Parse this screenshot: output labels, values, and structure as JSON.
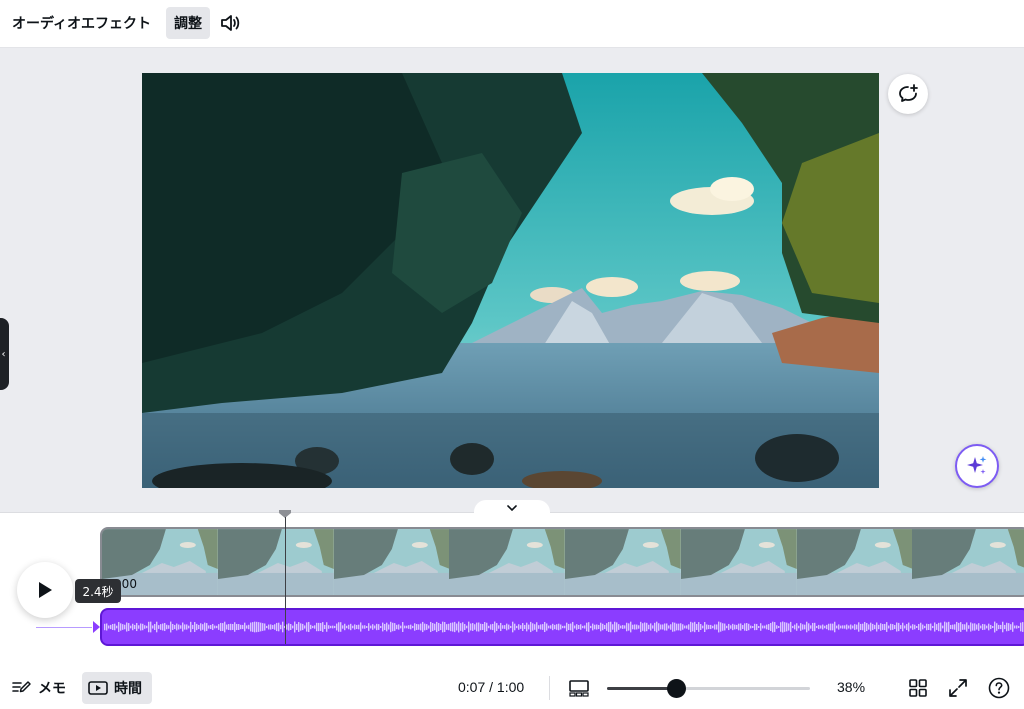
{
  "toolbar": {
    "audio_effects_label": "オーディオエフェクト",
    "adjust_label": "調整",
    "volume_icon": "speaker-icon"
  },
  "canvas": {
    "comment_icon": "comment-plus-icon",
    "magic_icon": "sparkle-icon",
    "side_handle_icon": "chevron-left-icon"
  },
  "timeline": {
    "collapse_icon": "chevron-down-icon",
    "track_time_label": "0:00",
    "tooltip": "2.4秒",
    "play_icon": "play-icon",
    "video_thumbnail_count": 8
  },
  "bottombar": {
    "memo_label": "メモ",
    "time_label": "時間",
    "timecode": "0:07 / 1:00",
    "zoom_percent": "38%",
    "zoom_value": 0.34,
    "icons": [
      "notes-icon",
      "timeline-icon",
      "layout-icon",
      "grid-icon",
      "fullscreen-icon",
      "help-icon"
    ]
  },
  "colors": {
    "accent": "#8b3dff",
    "accent_dark": "#5e17d6",
    "background": "#ebecf0",
    "text": "#0e1318"
  }
}
